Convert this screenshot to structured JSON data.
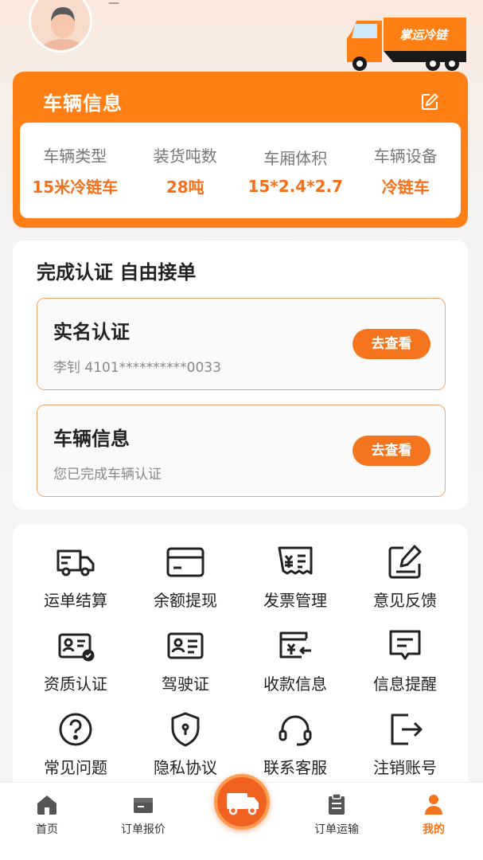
{
  "header": {
    "username": "—",
    "logo_text": "掌运冷链"
  },
  "vehicle": {
    "title": "车辆信息",
    "specs": [
      {
        "label": "车辆类型",
        "value": "15米冷链车"
      },
      {
        "label": "装货吨数",
        "value": "28吨"
      },
      {
        "label": "车厢体积",
        "value": "15*2.4*2.7"
      },
      {
        "label": "车辆设备",
        "value": "冷链车"
      }
    ]
  },
  "certification": {
    "heading": "完成认证 自由接单",
    "items": [
      {
        "title": "实名认证",
        "subtitle": "李钊 4101**********0033",
        "button": "去查看"
      },
      {
        "title": "车辆信息",
        "subtitle": "您已完成车辆认证",
        "button": "去查看"
      }
    ]
  },
  "services": [
    {
      "label": "运单结算",
      "icon": "truck-icon"
    },
    {
      "label": "余额提现",
      "icon": "card-icon"
    },
    {
      "label": "发票管理",
      "icon": "invoice-icon"
    },
    {
      "label": "意见反馈",
      "icon": "feedback-icon"
    },
    {
      "label": "资质认证",
      "icon": "qualification-icon"
    },
    {
      "label": "驾驶证",
      "icon": "license-icon"
    },
    {
      "label": "收款信息",
      "icon": "payment-icon"
    },
    {
      "label": "信息提醒",
      "icon": "message-icon"
    },
    {
      "label": "常见问题",
      "icon": "question-icon"
    },
    {
      "label": "隐私协议",
      "icon": "shield-icon"
    },
    {
      "label": "联系客服",
      "icon": "headset-icon"
    },
    {
      "label": "注销账号",
      "icon": "logout-icon"
    }
  ],
  "tabbar": {
    "tabs": [
      {
        "label": "首页",
        "icon": "home-icon"
      },
      {
        "label": "订单报价",
        "icon": "box-icon"
      },
      {
        "label": "订单运输",
        "icon": "clipboard-icon"
      },
      {
        "label": "我的",
        "icon": "user-icon",
        "active": true
      }
    ]
  },
  "colors": {
    "accent": "#f5751f",
    "card_orange": "#ff7f14"
  }
}
